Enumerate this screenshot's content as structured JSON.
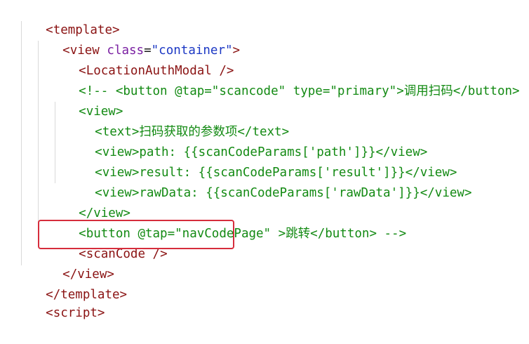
{
  "editor": {
    "lines": [
      {
        "tag_open": "<",
        "name": "template",
        "tag_close": ">"
      },
      {
        "tag_open": "<",
        "name": "view",
        "attr": "class",
        "eq": "=",
        "value": "\"container\"",
        "tag_close": ">"
      },
      {
        "tag_open": "<",
        "name": "LocationAuthModal",
        "tag_close": " />"
      },
      {
        "comment": "<!-- <button @tap=\"scancode\" type=\"primary\">调用扫码</button>"
      },
      {
        "comment": "<view>"
      },
      {
        "comment": "<text>扫码获取的参数项</text>"
      },
      {
        "comment": "<view>path: {{scanCodeParams['path']}}</view>"
      },
      {
        "comment": "<view>result: {{scanCodeParams['result']}}</view>"
      },
      {
        "comment": "<view>rawData: {{scanCodeParams['rawData']}}</view>"
      },
      {
        "comment": "</view>"
      },
      {
        "comment": "<button @tap=\"navCodePage\" >跳转</button> -->"
      },
      {
        "tag_open": "<",
        "name": "scanCode",
        "tag_close": " />"
      },
      {
        "tag_open": "</",
        "name": "view",
        "tag_close": ">"
      },
      {
        "tag_open": "</",
        "name": "template",
        "tag_close": ">"
      },
      {
        "tag_open": "<",
        "name": "script",
        "tag_close": ">"
      }
    ]
  },
  "highlight": {
    "color": "#d62d3c",
    "target": "scanCode"
  },
  "colors": {
    "tag": "#8a1212",
    "attribute": "#7a1fa2",
    "string": "#1c38c4",
    "comment": "#138a13",
    "indent_guide": "#d9d9d9"
  }
}
